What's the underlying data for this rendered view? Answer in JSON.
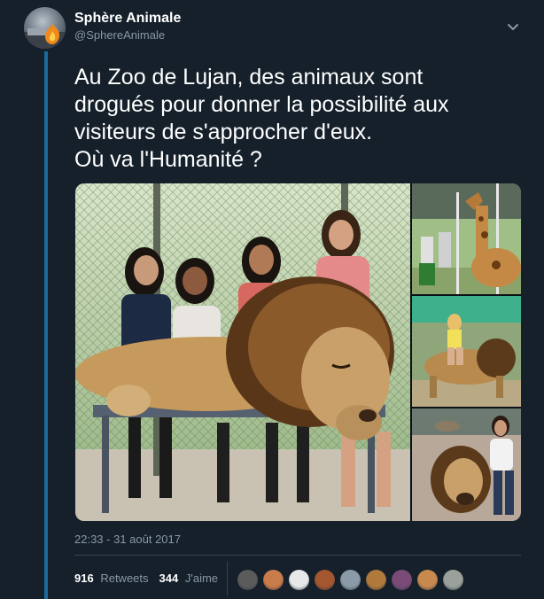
{
  "user": {
    "display_name": "Sphère Animale",
    "screen_name": "@SphereAnimale"
  },
  "tweet": {
    "text_lines": [
      "Au Zoo de Lujan, des animaux sont",
      "drogués pour donner la possibilité aux",
      "visiteurs de s'approcher d'eux.",
      "Où va l'Humanité ?"
    ],
    "timestamp": "22:33 - 31 août 2017"
  },
  "stats": {
    "retweets_count": "916",
    "retweets_label": "Retweets",
    "likes_count": "344",
    "likes_label": "J'aime"
  },
  "media": {
    "photos": [
      {
        "icon": "photo-lion-with-visitors"
      },
      {
        "icon": "photo-giraffe"
      },
      {
        "icon": "photo-visitor-riding-lion"
      },
      {
        "icon": "photo-lion-with-visitor"
      }
    ]
  },
  "likers": [
    {
      "color": "#5b5b5b"
    },
    {
      "color": "#c97b4a"
    },
    {
      "color": "#e8e8e8"
    },
    {
      "color": "#a4562f"
    },
    {
      "color": "#8a9aa7"
    },
    {
      "color": "#b07a3c"
    },
    {
      "color": "#7b4b78"
    },
    {
      "color": "#c7894e"
    },
    {
      "color": "#9aa19a"
    }
  ],
  "colors": {
    "background": "#15202b",
    "secondary_text": "#8899a6",
    "thread_line": "#1b6a9c",
    "divider": "#38444d"
  }
}
